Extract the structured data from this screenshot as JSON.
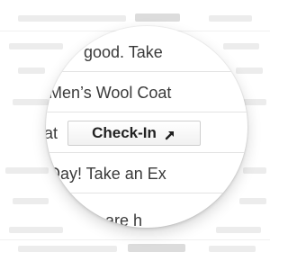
{
  "rows": [
    {
      "text": "good. Take"
    },
    {
      "text": "Men’s Wool Coat"
    },
    {
      "prefix": "at",
      "button_label": "Check-In",
      "button_icon": "external-arrow-icon"
    },
    {
      "text": "Day! Take an Ex"
    },
    {
      "text": "are h"
    }
  ]
}
